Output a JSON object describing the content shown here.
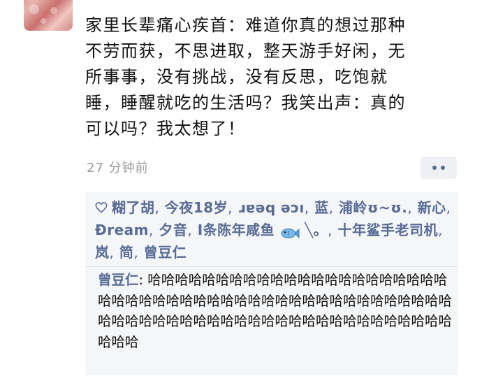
{
  "post": {
    "author_partial": "· · ·",
    "lines": [
      "家里长辈痛心疾首：难道你真的想过那种",
      "不劳而获，不思进取，整天游手好闲，无",
      "所事事，没有挑战，没有反思，吃饱就",
      "睡，睡醒就吃的生活吗？我笑出声：真的",
      "可以吗？我太想了！"
    ],
    "timestamp": "27 分钟前"
  },
  "likes": {
    "icon": "heart-outline-icon",
    "names": [
      "糊了胡",
      "今夜18岁",
      "ɹɐəq əɔı",
      "蓝",
      "浦岭ʊ~ʊ.",
      "新心",
      "Ðream",
      "夕音",
      "I条陈年咸鱼",
      "╲。",
      "十年鲨手老司机",
      "岚",
      "简",
      "曾豆仁"
    ],
    "separator": ","
  },
  "comment": {
    "commenter": "曾豆仁",
    "colon": ":",
    "text": "哈哈哈哈哈哈哈哈哈哈哈哈哈哈哈哈哈哈哈哈哈哈哈哈哈哈哈哈哈哈哈哈哈哈哈哈哈哈哈哈哈哈哈哈哈哈哈哈哈哈哈哈哈哈哈哈哈哈哈哈哈哈哈哈哈哈哈哈哈哈哈哈哈哈哈哈哈"
  },
  "colors": {
    "link": "#576b95",
    "timestamp": "#9b9b9b",
    "panel_bg": "#f5f6f8",
    "text": "#111111"
  }
}
